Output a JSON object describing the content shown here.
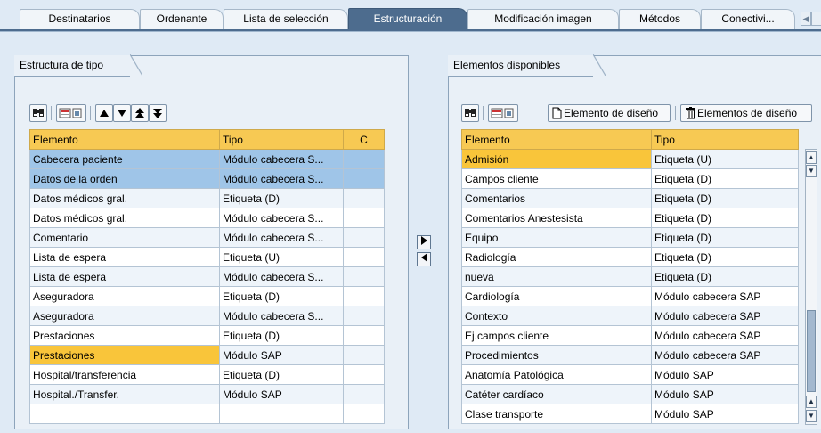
{
  "tabs": [
    {
      "label": "Destinatarios"
    },
    {
      "label": "Ordenante"
    },
    {
      "label": "Lista de selección"
    },
    {
      "label": "Estructuración",
      "active": true
    },
    {
      "label": "Modificación imagen"
    },
    {
      "label": "Métodos"
    },
    {
      "label": "Conectivi..."
    }
  ],
  "left_panel": {
    "title": "Estructura de tipo",
    "columns": [
      "Elemento",
      "Tipo",
      "C"
    ],
    "rows": [
      {
        "elemento": "Cabecera paciente",
        "tipo": "Módulo cabecera S...",
        "c": ""
      },
      {
        "elemento": "Datos de la orden",
        "tipo": "Módulo cabecera S...",
        "c": ""
      },
      {
        "elemento": "Datos médicos gral.",
        "tipo": "Etiqueta (D)",
        "c": ""
      },
      {
        "elemento": "Datos médicos gral.",
        "tipo": "Módulo cabecera S...",
        "c": ""
      },
      {
        "elemento": "Comentario",
        "tipo": "Módulo cabecera S...",
        "c": ""
      },
      {
        "elemento": "Lista de espera",
        "tipo": "Etiqueta (U)",
        "c": ""
      },
      {
        "elemento": "Lista de espera",
        "tipo": "Módulo cabecera S...",
        "c": ""
      },
      {
        "elemento": "Aseguradora",
        "tipo": "Etiqueta (D)",
        "c": ""
      },
      {
        "elemento": "Aseguradora",
        "tipo": "Módulo cabecera S...",
        "c": ""
      },
      {
        "elemento": "Prestaciones",
        "tipo": "Etiqueta (D)",
        "c": ""
      },
      {
        "elemento": "Prestaciones",
        "tipo": "Módulo SAP",
        "c": ""
      },
      {
        "elemento": "Hospital/transferencia",
        "tipo": "Etiqueta (D)",
        "c": ""
      },
      {
        "elemento": "Hospital./Transfer.",
        "tipo": "Módulo SAP",
        "c": ""
      }
    ]
  },
  "right_panel": {
    "title": "Elementos disponibles",
    "toolbar": {
      "new_element_label": "Elemento de diseño",
      "delete_elements_label": "Elementos de diseño"
    },
    "columns": [
      "Elemento",
      "Tipo"
    ],
    "rows": [
      {
        "elemento": "Admisión",
        "tipo": "Etiqueta (U)"
      },
      {
        "elemento": "Campos cliente",
        "tipo": "Etiqueta (D)"
      },
      {
        "elemento": "Comentarios",
        "tipo": "Etiqueta (D)"
      },
      {
        "elemento": "Comentarios Anestesista",
        "tipo": "Etiqueta (D)"
      },
      {
        "elemento": "Equipo",
        "tipo": "Etiqueta (D)"
      },
      {
        "elemento": "Radiología",
        "tipo": "Etiqueta (D)"
      },
      {
        "elemento": "nueva",
        "tipo": "Etiqueta (D)"
      },
      {
        "elemento": "Cardiología",
        "tipo": "Módulo cabecera SAP"
      },
      {
        "elemento": "Contexto",
        "tipo": "Módulo cabecera SAP"
      },
      {
        "elemento": "Ej.campos cliente",
        "tipo": "Módulo cabecera SAP"
      },
      {
        "elemento": "Procedimientos",
        "tipo": "Módulo cabecera SAP"
      },
      {
        "elemento": "Anatomía Patológica",
        "tipo": "Módulo SAP"
      },
      {
        "elemento": "Catéter cardíaco",
        "tipo": "Módulo SAP"
      },
      {
        "elemento": "Clase transporte",
        "tipo": "Módulo SAP"
      }
    ]
  },
  "colors": {
    "active_tab": "#4d6c8e",
    "header": "#f7c953",
    "selected_row": "#9fc5e8",
    "highlight_cell": "#f9c53a"
  },
  "icons": [
    "find-icon",
    "layout-icon",
    "move-up-icon",
    "move-down-icon",
    "move-top-icon",
    "move-bottom-icon",
    "new-document-icon",
    "trash-icon",
    "arrow-right-icon",
    "arrow-left-icon"
  ]
}
